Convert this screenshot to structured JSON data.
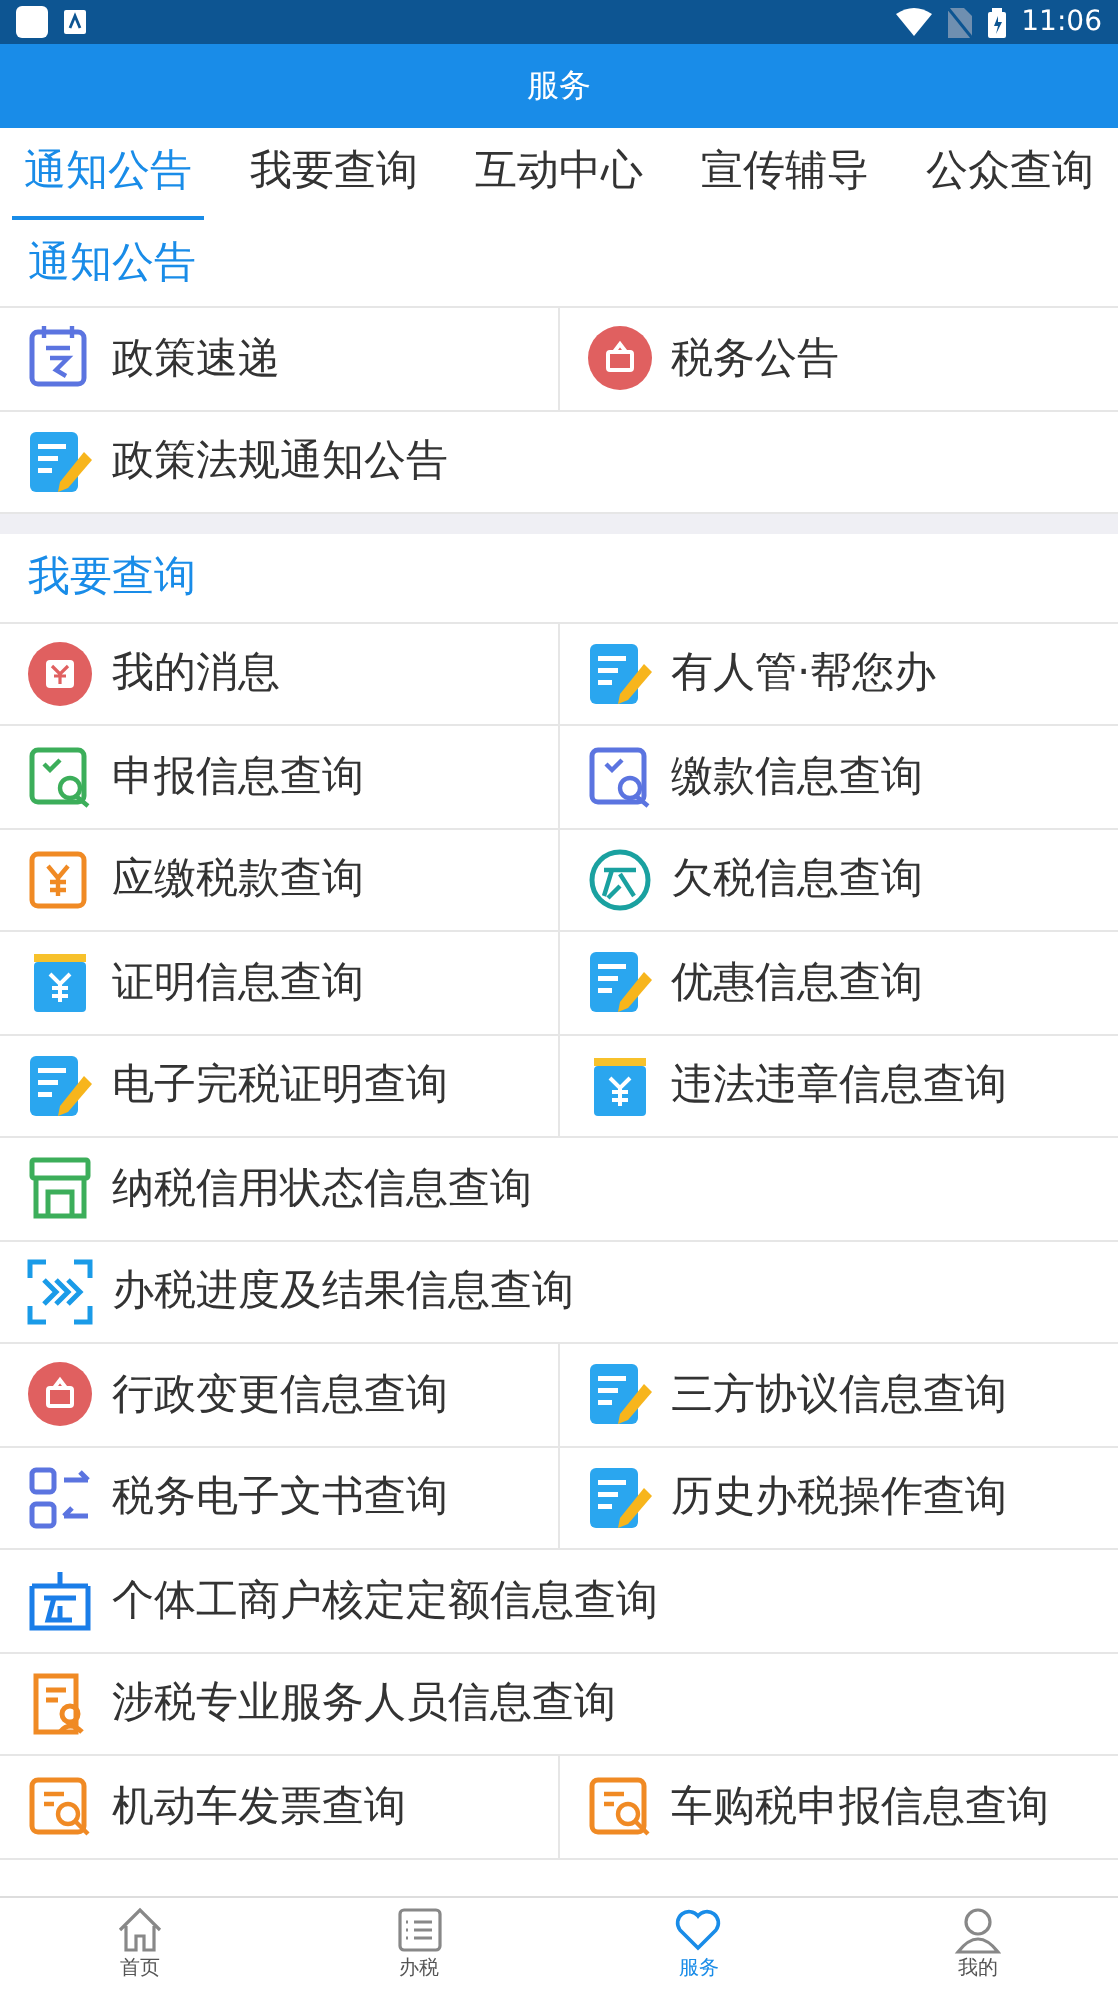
{
  "status_bar": {
    "time": "11:06"
  },
  "header": {
    "title": "服务"
  },
  "tabs": [
    {
      "label": "通知公告",
      "selected": true
    },
    {
      "label": "我要查询",
      "selected": false
    },
    {
      "label": "互动中心",
      "selected": false
    },
    {
      "label": "宣传辅导",
      "selected": false
    },
    {
      "label": "公众查询",
      "selected": false
    }
  ],
  "sections": [
    {
      "title": "通知公告",
      "items": [
        {
          "label": "政策速递",
          "kind": "half"
        },
        {
          "label": "税务公告",
          "kind": "half"
        },
        {
          "label": "政策法规通知公告",
          "kind": "full"
        }
      ]
    },
    {
      "title": "我要查询",
      "items": [
        {
          "label": "我的消息",
          "kind": "half"
        },
        {
          "label": "有人管·帮您办",
          "kind": "half"
        },
        {
          "label": "申报信息查询",
          "kind": "half"
        },
        {
          "label": "缴款信息查询",
          "kind": "half"
        },
        {
          "label": "应缴税款查询",
          "kind": "half"
        },
        {
          "label": "欠税信息查询",
          "kind": "half"
        },
        {
          "label": "证明信息查询",
          "kind": "half"
        },
        {
          "label": "优惠信息查询",
          "kind": "half"
        },
        {
          "label": "电子完税证明查询",
          "kind": "half"
        },
        {
          "label": "违法违章信息查询",
          "kind": "half"
        },
        {
          "label": "纳税信用状态信息查询",
          "kind": "full"
        },
        {
          "label": "办税进度及结果信息查询",
          "kind": "full"
        },
        {
          "label": "行政变更信息查询",
          "kind": "half"
        },
        {
          "label": "三方协议信息查询",
          "kind": "half"
        },
        {
          "label": "税务电子文书查询",
          "kind": "half"
        },
        {
          "label": "历史办税操作查询",
          "kind": "half"
        },
        {
          "label": "个体工商户核定定额信息查询",
          "kind": "full"
        },
        {
          "label": "涉税专业服务人员信息查询",
          "kind": "full"
        },
        {
          "label": "机动车发票查询",
          "kind": "half"
        },
        {
          "label": "车购税申报信息查询",
          "kind": "half"
        }
      ]
    }
  ],
  "bottom_nav": [
    {
      "label": "首页",
      "selected": false
    },
    {
      "label": "办税",
      "selected": false
    },
    {
      "label": "服务",
      "selected": true
    },
    {
      "label": "我的",
      "selected": false
    }
  ]
}
